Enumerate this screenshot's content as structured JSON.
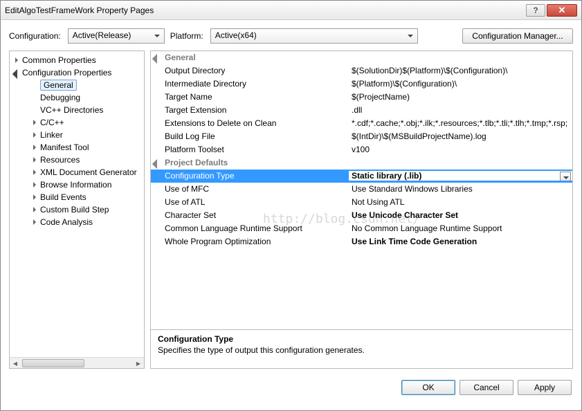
{
  "title": "EditAlgoTestFrameWork Property Pages",
  "helpGlyph": "?",
  "closeGlyph": "✕",
  "cfgbar": {
    "configLabel": "Configuration:",
    "configValue": "Active(Release)",
    "platformLabel": "Platform:",
    "platformValue": "Active(x64)",
    "managerBtn": "Configuration Manager..."
  },
  "tree": [
    {
      "lvl": 1,
      "tri": "closed",
      "label": "Common Properties"
    },
    {
      "lvl": 1,
      "tri": "open",
      "label": "Configuration Properties"
    },
    {
      "lvl": 3,
      "label": "General",
      "selected": true
    },
    {
      "lvl": 3,
      "label": "Debugging"
    },
    {
      "lvl": 3,
      "label": "VC++ Directories"
    },
    {
      "lvl": 2,
      "tri": "closed",
      "label": "C/C++"
    },
    {
      "lvl": 2,
      "tri": "closed",
      "label": "Linker"
    },
    {
      "lvl": 2,
      "tri": "closed",
      "label": "Manifest Tool"
    },
    {
      "lvl": 2,
      "tri": "closed",
      "label": "Resources"
    },
    {
      "lvl": 2,
      "tri": "closed",
      "label": "XML Document Generator"
    },
    {
      "lvl": 2,
      "tri": "closed",
      "label": "Browse Information"
    },
    {
      "lvl": 2,
      "tri": "closed",
      "label": "Build Events"
    },
    {
      "lvl": 2,
      "tri": "closed",
      "label": "Custom Build Step"
    },
    {
      "lvl": 2,
      "tri": "closed",
      "label": "Code Analysis"
    }
  ],
  "grid": [
    {
      "cat": true,
      "name": "General"
    },
    {
      "name": "Output Directory",
      "val": "$(SolutionDir)$(Platform)\\$(Configuration)\\"
    },
    {
      "name": "Intermediate Directory",
      "val": "$(Platform)\\$(Configuration)\\"
    },
    {
      "name": "Target Name",
      "val": "$(ProjectName)"
    },
    {
      "name": "Target Extension",
      "val": ".dll"
    },
    {
      "name": "Extensions to Delete on Clean",
      "val": "*.cdf;*.cache;*.obj;*.ilk;*.resources;*.tlb;*.tli;*.tlh;*.tmp;*.rsp;"
    },
    {
      "name": "Build Log File",
      "val": "$(IntDir)\\$(MSBuildProjectName).log"
    },
    {
      "name": "Platform Toolset",
      "val": "v100"
    },
    {
      "cat": true,
      "name": "Project Defaults"
    },
    {
      "name": "Configuration Type",
      "val": "Static library (.lib)",
      "bold": true,
      "selected": true,
      "dd": true
    },
    {
      "name": "Use of MFC",
      "val": "Use Standard Windows Libraries"
    },
    {
      "name": "Use of ATL",
      "val": "Not Using ATL"
    },
    {
      "name": "Character Set",
      "val": "Use Unicode Character Set",
      "bold": true
    },
    {
      "name": "Common Language Runtime Support",
      "val": "No Common Language Runtime Support"
    },
    {
      "name": "Whole Program Optimization",
      "val": "Use Link Time Code Generation",
      "bold": true
    }
  ],
  "desc": {
    "title": "Configuration Type",
    "text": "Specifies the type of output this configuration generates."
  },
  "footer": {
    "ok": "OK",
    "cancel": "Cancel",
    "apply": "Apply"
  },
  "watermark": "http://blog.csdn.net/"
}
